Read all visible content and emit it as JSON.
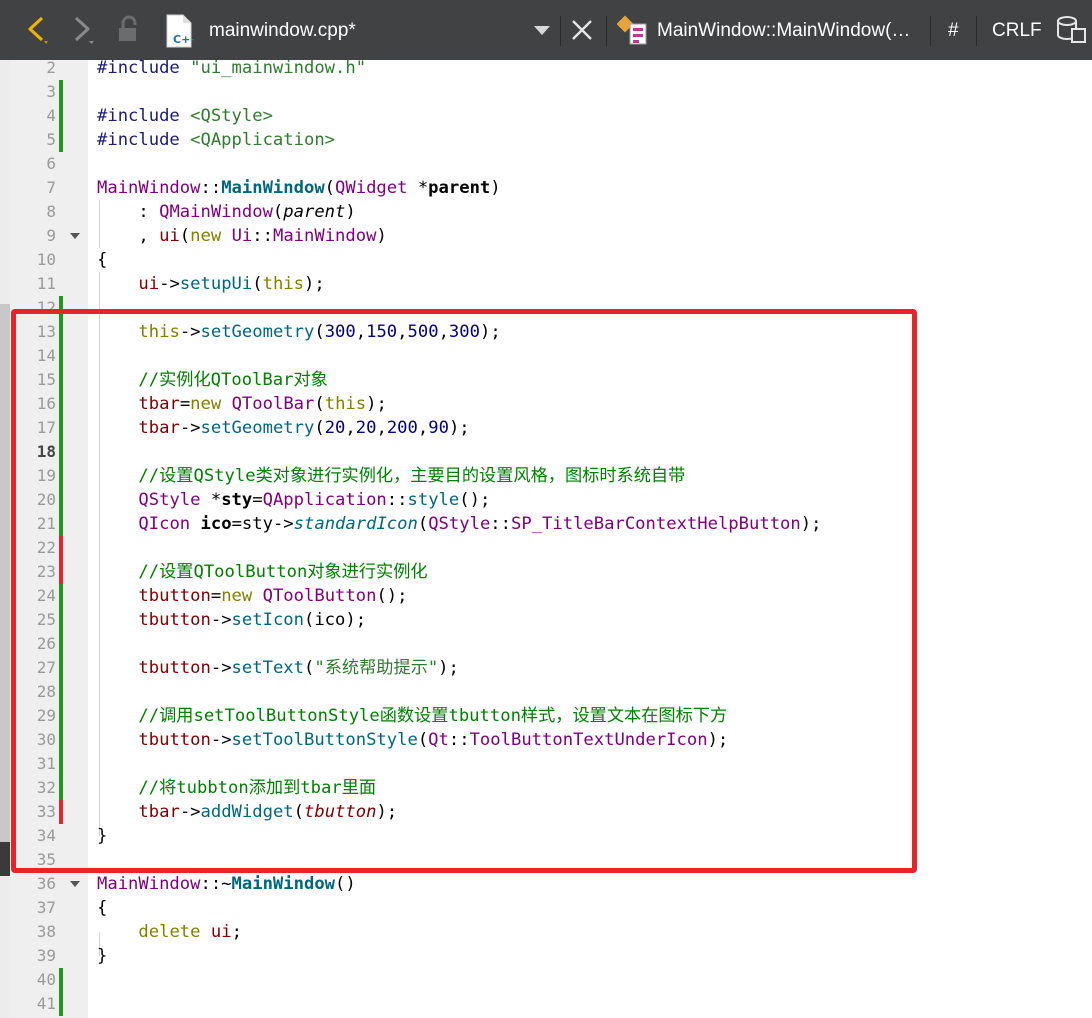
{
  "toolbar": {
    "file_name": "mainwindow.cpp*",
    "symbol": "MainWindow::MainWindow(…",
    "hash": "#",
    "line_ending": "CRLF"
  },
  "code_lines": [
    {
      "n": "2",
      "mark": "",
      "fold": false,
      "tokens": [
        [
          "c-macro",
          "#include "
        ],
        [
          "c-str",
          "\"ui_mainwindow.h\""
        ]
      ]
    },
    {
      "n": "3",
      "mark": "g",
      "fold": false,
      "tokens": []
    },
    {
      "n": "4",
      "mark": "g",
      "fold": false,
      "tokens": [
        [
          "c-macro",
          "#include "
        ],
        [
          "c-str",
          "<QStyle>"
        ]
      ]
    },
    {
      "n": "5",
      "mark": "g",
      "fold": false,
      "tokens": [
        [
          "c-macro",
          "#include "
        ],
        [
          "c-str",
          "<QApplication>"
        ]
      ]
    },
    {
      "n": "6",
      "mark": "",
      "fold": false,
      "tokens": []
    },
    {
      "n": "7",
      "mark": "",
      "fold": false,
      "tokens": [
        [
          "c-type",
          "MainWindow"
        ],
        [
          "",
          "::"
        ],
        [
          "c-fnb",
          "MainWindow"
        ],
        [
          "",
          "("
        ],
        [
          "c-type",
          "QWidget"
        ],
        [
          "",
          " *"
        ],
        [
          "c-b",
          "parent"
        ],
        [
          "",
          ")"
        ]
      ]
    },
    {
      "n": "8",
      "mark": "",
      "fold": false,
      "tokens": [
        [
          "",
          "    : "
        ],
        [
          "c-type",
          "QMainWindow"
        ],
        [
          "",
          "("
        ],
        [
          "c-it",
          "parent"
        ],
        [
          "",
          ")"
        ]
      ]
    },
    {
      "n": "9",
      "mark": "",
      "fold": true,
      "tokens": [
        [
          "",
          "    , "
        ],
        [
          "c-fld",
          "ui"
        ],
        [
          "",
          "("
        ],
        [
          "c-kw",
          "new"
        ],
        [
          "",
          " "
        ],
        [
          "c-ns",
          "Ui"
        ],
        [
          "",
          "::"
        ],
        [
          "c-type",
          "MainWindow"
        ],
        [
          "",
          ")"
        ]
      ]
    },
    {
      "n": "10",
      "mark": "",
      "fold": false,
      "tokens": [
        [
          "",
          "{"
        ]
      ]
    },
    {
      "n": "11",
      "mark": "",
      "fold": false,
      "tokens": [
        [
          "",
          "    "
        ],
        [
          "c-fld",
          "ui"
        ],
        [
          "",
          "->"
        ],
        [
          "c-fn",
          "setupUi"
        ],
        [
          "",
          "("
        ],
        [
          "c-kw",
          "this"
        ],
        [
          "",
          ");"
        ]
      ]
    },
    {
      "n": "12",
      "mark": "g",
      "fold": false,
      "tokens": []
    },
    {
      "n": "13",
      "mark": "g",
      "fold": false,
      "tokens": [
        [
          "",
          "    "
        ],
        [
          "c-kw",
          "this"
        ],
        [
          "",
          "->"
        ],
        [
          "c-fn",
          "setGeometry"
        ],
        [
          "",
          "("
        ],
        [
          "c-num",
          "300"
        ],
        [
          "",
          ","
        ],
        [
          "c-num",
          "150"
        ],
        [
          "",
          ","
        ],
        [
          "c-num",
          "500"
        ],
        [
          "",
          ","
        ],
        [
          "c-num",
          "300"
        ],
        [
          "",
          ");"
        ]
      ]
    },
    {
      "n": "14",
      "mark": "g",
      "fold": false,
      "tokens": []
    },
    {
      "n": "15",
      "mark": "g",
      "fold": false,
      "tokens": [
        [
          "",
          "    "
        ],
        [
          "c-cm",
          "//实例化QToolBar对象"
        ]
      ]
    },
    {
      "n": "16",
      "mark": "g",
      "fold": false,
      "tokens": [
        [
          "",
          "    "
        ],
        [
          "c-fld",
          "tbar"
        ],
        [
          "",
          "="
        ],
        [
          "c-kw",
          "new"
        ],
        [
          "",
          " "
        ],
        [
          "c-type",
          "QToolBar"
        ],
        [
          "",
          "("
        ],
        [
          "c-kw",
          "this"
        ],
        [
          "",
          ");"
        ]
      ]
    },
    {
      "n": "17",
      "mark": "g",
      "fold": false,
      "tokens": [
        [
          "",
          "    "
        ],
        [
          "c-fld",
          "tbar"
        ],
        [
          "",
          "->"
        ],
        [
          "c-fn",
          "setGeometry"
        ],
        [
          "",
          "("
        ],
        [
          "c-num",
          "20"
        ],
        [
          "",
          ","
        ],
        [
          "c-num",
          "20"
        ],
        [
          "",
          ","
        ],
        [
          "c-num",
          "200"
        ],
        [
          "",
          ","
        ],
        [
          "c-num",
          "90"
        ],
        [
          "",
          ");"
        ]
      ]
    },
    {
      "n": "18",
      "mark": "g",
      "fold": false,
      "cur": true,
      "tokens": []
    },
    {
      "n": "19",
      "mark": "g",
      "fold": false,
      "tokens": [
        [
          "",
          "    "
        ],
        [
          "c-cm",
          "//设置QStyle类对象进行实例化，主要目的设置风格，图标时系统自带"
        ]
      ]
    },
    {
      "n": "20",
      "mark": "g",
      "fold": false,
      "tokens": [
        [
          "",
          "    "
        ],
        [
          "c-type",
          "QStyle"
        ],
        [
          "",
          " *"
        ],
        [
          "c-b",
          "sty"
        ],
        [
          "",
          "="
        ],
        [
          "c-type",
          "QApplication"
        ],
        [
          "",
          "::"
        ],
        [
          "c-fn",
          "style"
        ],
        [
          "",
          "();"
        ]
      ]
    },
    {
      "n": "21",
      "mark": "g",
      "fold": false,
      "tokens": [
        [
          "",
          "    "
        ],
        [
          "c-type",
          "QIcon"
        ],
        [
          "",
          " "
        ],
        [
          "c-b",
          "ico"
        ],
        [
          "",
          "=sty->"
        ],
        [
          "c-fn c-it",
          "standardIcon"
        ],
        [
          "",
          "("
        ],
        [
          "c-type",
          "QStyle"
        ],
        [
          "",
          "::"
        ],
        [
          "c-type",
          "SP_TitleBarContextHelpButton"
        ],
        [
          "",
          ");"
        ]
      ]
    },
    {
      "n": "22",
      "mark": "r",
      "fold": false,
      "tokens": []
    },
    {
      "n": "23",
      "mark": "r",
      "fold": false,
      "tokens": [
        [
          "",
          "    "
        ],
        [
          "c-cm",
          "//设置QToolButton对象进行实例化"
        ]
      ]
    },
    {
      "n": "24",
      "mark": "g",
      "fold": false,
      "tokens": [
        [
          "",
          "    "
        ],
        [
          "c-fld",
          "tbutton"
        ],
        [
          "",
          "="
        ],
        [
          "c-kw",
          "new"
        ],
        [
          "",
          " "
        ],
        [
          "c-type",
          "QToolButton"
        ],
        [
          "",
          "();"
        ]
      ]
    },
    {
      "n": "25",
      "mark": "g",
      "fold": false,
      "tokens": [
        [
          "",
          "    "
        ],
        [
          "c-fld",
          "tbutton"
        ],
        [
          "",
          "->"
        ],
        [
          "c-fn",
          "setIcon"
        ],
        [
          "",
          "(ico);"
        ]
      ]
    },
    {
      "n": "26",
      "mark": "g",
      "fold": false,
      "tokens": []
    },
    {
      "n": "27",
      "mark": "g",
      "fold": false,
      "tokens": [
        [
          "",
          "    "
        ],
        [
          "c-fld",
          "tbutton"
        ],
        [
          "",
          "->"
        ],
        [
          "c-fn",
          "setText"
        ],
        [
          "",
          "("
        ],
        [
          "c-str",
          "\"系统帮助提示\""
        ],
        [
          "",
          ");"
        ]
      ]
    },
    {
      "n": "28",
      "mark": "g",
      "fold": false,
      "tokens": []
    },
    {
      "n": "29",
      "mark": "g",
      "fold": false,
      "tokens": [
        [
          "",
          "    "
        ],
        [
          "c-cm",
          "//调用setToolButtonStyle函数设置tbutton样式，设置文本在图标下方"
        ]
      ]
    },
    {
      "n": "30",
      "mark": "g",
      "fold": false,
      "tokens": [
        [
          "",
          "    "
        ],
        [
          "c-fld",
          "tbutton"
        ],
        [
          "",
          "->"
        ],
        [
          "c-fn",
          "setToolButtonStyle"
        ],
        [
          "",
          "("
        ],
        [
          "c-ns",
          "Qt"
        ],
        [
          "",
          "::"
        ],
        [
          "c-type",
          "ToolButtonTextUnderIcon"
        ],
        [
          "",
          ");"
        ]
      ]
    },
    {
      "n": "31",
      "mark": "g",
      "fold": false,
      "tokens": []
    },
    {
      "n": "32",
      "mark": "g",
      "fold": false,
      "tokens": [
        [
          "",
          "    "
        ],
        [
          "c-cm",
          "//将tubbton添加到tbar里面"
        ]
      ]
    },
    {
      "n": "33",
      "mark": "r",
      "fold": false,
      "tokens": [
        [
          "",
          "    "
        ],
        [
          "c-fld",
          "tbar"
        ],
        [
          "",
          "->"
        ],
        [
          "c-fn",
          "addWidget"
        ],
        [
          "",
          "("
        ],
        [
          "c-fld c-it",
          "tbutton"
        ],
        [
          "",
          ");"
        ]
      ]
    },
    {
      "n": "34",
      "mark": "",
      "fold": false,
      "tokens": [
        [
          "",
          "}"
        ]
      ]
    },
    {
      "n": "35",
      "mark": "",
      "fold": false,
      "tokens": []
    },
    {
      "n": "36",
      "mark": "",
      "fold": true,
      "tokens": [
        [
          "c-type",
          "MainWindow"
        ],
        [
          "",
          "::~"
        ],
        [
          "c-fnb",
          "MainWindow"
        ],
        [
          "",
          "()"
        ]
      ]
    },
    {
      "n": "37",
      "mark": "",
      "fold": false,
      "tokens": [
        [
          "",
          "{"
        ]
      ]
    },
    {
      "n": "38",
      "mark": "",
      "fold": false,
      "tokens": [
        [
          "",
          "    "
        ],
        [
          "c-kw",
          "delete"
        ],
        [
          "",
          " "
        ],
        [
          "c-fld",
          "ui"
        ],
        [
          "",
          ";"
        ]
      ]
    },
    {
      "n": "39",
      "mark": "",
      "fold": false,
      "tokens": [
        [
          "",
          "}"
        ]
      ]
    },
    {
      "n": "40",
      "mark": "g",
      "fold": false,
      "tokens": []
    },
    {
      "n": "41",
      "mark": "g",
      "fold": false,
      "tokens": []
    }
  ],
  "icons": {
    "back": "chevron-left-icon",
    "forward": "chevron-right-icon",
    "lock": "lock-icon",
    "file": "cpp-file-icon",
    "dropdown": "chevron-down-icon",
    "close": "close-icon",
    "symbol": "class-symbol-icon",
    "split": "split-view-icon"
  },
  "colors": {
    "toolbar_bg": "#404244",
    "highlight_box": "#e8232a",
    "added_marker": "#1f9a1f",
    "modified_marker": "#e02a2a"
  }
}
